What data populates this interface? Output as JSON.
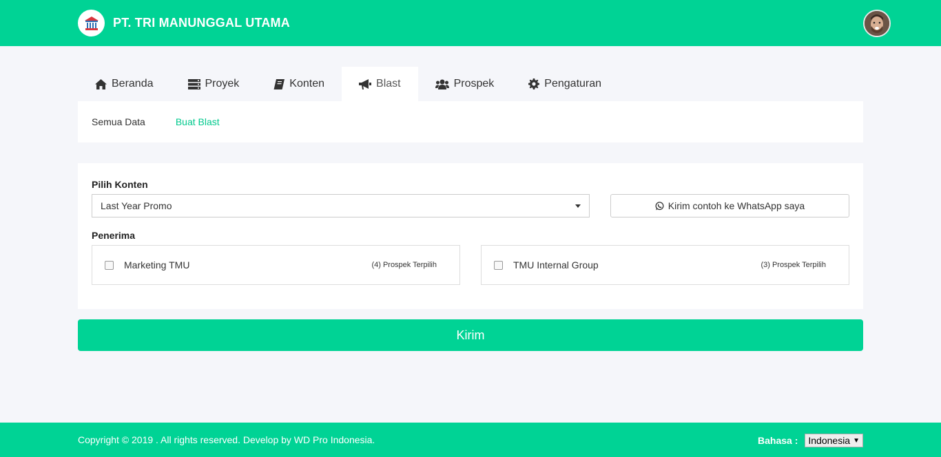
{
  "header": {
    "company_name": "PT. TRI MANUNGGAL UTAMA",
    "brand_color": "#00d395"
  },
  "tabs": [
    {
      "label": "Beranda",
      "icon": "home-icon"
    },
    {
      "label": "Proyek",
      "icon": "server-icon"
    },
    {
      "label": "Konten",
      "icon": "book-icon"
    },
    {
      "label": "Blast",
      "icon": "bullhorn-icon",
      "active": true
    },
    {
      "label": "Prospek",
      "icon": "users-icon"
    },
    {
      "label": "Pengaturan",
      "icon": "gear-icon"
    }
  ],
  "subnav": {
    "all_data": "Semua Data",
    "create_blast": "Buat Blast"
  },
  "form": {
    "content_label": "Pilih Konten",
    "content_value": "Last Year Promo",
    "whatsapp_button": "Kirim contoh ke WhatsApp saya",
    "recipients_label": "Penerima",
    "recipients": [
      {
        "name": "Marketing TMU",
        "count": "(4) Prospek Terpilih",
        "checked": false
      },
      {
        "name": "TMU Internal Group",
        "count": "(3) Prospek Terpilih",
        "checked": false
      }
    ],
    "submit": "Kirim"
  },
  "footer": {
    "copyright": "Copyright © 2019 . All rights reserved. Develop by WD Pro Indonesia.",
    "language_label": "Bahasa :",
    "language_value": "Indonesia"
  }
}
